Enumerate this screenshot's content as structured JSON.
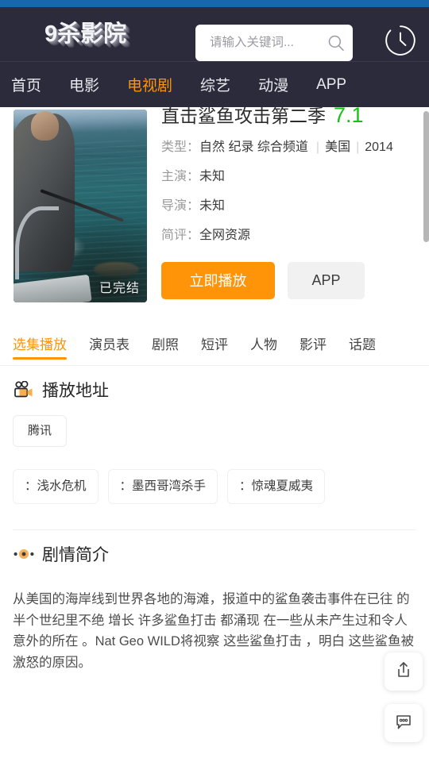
{
  "header": {
    "logo": "9杀影院",
    "search": {
      "placeholder": "请输入关键词...",
      "value": "",
      "icon": "search-icon"
    },
    "history_icon": "clock-icon",
    "accent_color": "#ff9409",
    "background_color": "#2b2b3c",
    "status_bar_color": "#1767ad",
    "nav": [
      {
        "label": "首页",
        "active": false
      },
      {
        "label": "电影",
        "active": false
      },
      {
        "label": "电视剧",
        "active": true
      },
      {
        "label": "综艺",
        "active": false
      },
      {
        "label": "动漫",
        "active": false
      },
      {
        "label": "APP",
        "active": false
      }
    ]
  },
  "detail": {
    "poster_badge": "已完结",
    "title": "直击鲨鱼攻击第二季",
    "rating": "7.1",
    "rating_color": "#14c314",
    "meta": [
      {
        "label": "类型：",
        "tags": [
          "自然",
          "纪录",
          "综合频道"
        ],
        "extra": [
          "美国",
          "2014"
        ]
      },
      {
        "label": "主演：",
        "value": "未知"
      },
      {
        "label": "导演：",
        "value": "未知"
      },
      {
        "label": "简评：",
        "value": "全网资源"
      }
    ],
    "meta_label_type": "类型：",
    "meta_tags_type": "自然 纪录 综合频道",
    "meta_region": "美国",
    "meta_year": "2014",
    "meta_label_actor": "主演：",
    "meta_value_actor": "未知",
    "meta_label_director": "导演：",
    "meta_value_director": "未知",
    "meta_label_review": "简评：",
    "meta_value_review": "全网资源",
    "play_button": "立即播放",
    "app_button": "APP"
  },
  "tabs": [
    {
      "label": "选集播放",
      "active": true
    },
    {
      "label": "演员表",
      "active": false
    },
    {
      "label": "剧照",
      "active": false
    },
    {
      "label": "短评",
      "active": false
    },
    {
      "label": "人物",
      "active": false
    },
    {
      "label": "影评",
      "active": false
    },
    {
      "label": "话题",
      "active": false
    }
  ],
  "play_section": {
    "icon": "video-camera-icon",
    "title": "播放地址",
    "sources": [
      "腾讯"
    ],
    "episodes": [
      "：浅水危机",
      "：墨西哥湾杀手",
      "：惊魂夏威夷"
    ]
  },
  "synopsis_section": {
    "icon": "dots-icon",
    "title": "剧情简介",
    "text": "从美国的海岸线到世界各地的海滩，报道中的鲨鱼袭击事件在已往 的半个世纪里不绝 增长 许多鲨鱼打击 都涌现 在一些从未产生过和令人意外的所在 。Nat Geo WILD将视察 这些鲨鱼打击 ，明白 这些鲨鱼被激怒的原因。"
  },
  "floating": {
    "share_icon": "share-icon",
    "comment_icon": "comment-icon"
  }
}
